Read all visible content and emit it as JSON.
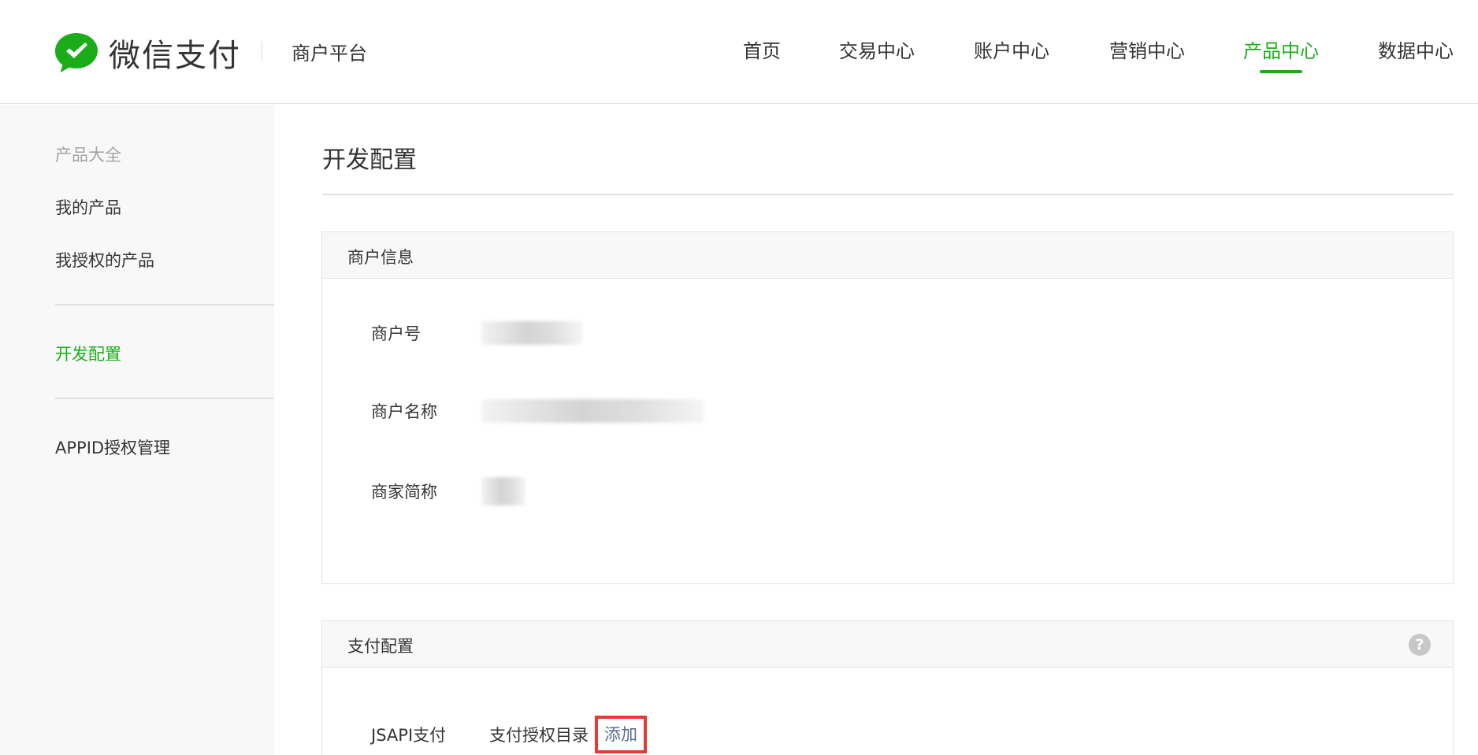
{
  "brand": {
    "logo_text": "微信支付",
    "platform": "商户平台",
    "accent_color": "#1aad19"
  },
  "nav": {
    "items": [
      {
        "label": "首页",
        "active": false
      },
      {
        "label": "交易中心",
        "active": false
      },
      {
        "label": "账户中心",
        "active": false
      },
      {
        "label": "营销中心",
        "active": false
      },
      {
        "label": "产品中心",
        "active": true
      },
      {
        "label": "数据中心",
        "active": false
      }
    ]
  },
  "sidebar": {
    "items": [
      {
        "label": "产品大全",
        "state": "muted"
      },
      {
        "label": "我的产品",
        "state": "normal"
      },
      {
        "label": "我授权的产品",
        "state": "normal"
      },
      {
        "label": "开发配置",
        "state": "active"
      },
      {
        "label": "APPID授权管理",
        "state": "normal"
      }
    ]
  },
  "main": {
    "title": "开发配置",
    "merchant_info": {
      "heading": "商户信息",
      "rows": [
        {
          "label": "商户号",
          "value_redacted": true
        },
        {
          "label": "商户名称",
          "value_redacted": true
        },
        {
          "label": "商家简称",
          "value_redacted": true
        }
      ]
    },
    "payment_config": {
      "heading": "支付配置",
      "help_icon": "help-circle-icon",
      "help_glyph": "?",
      "jsapi": {
        "label": "JSAPI支付",
        "dir_label": "支付授权目录",
        "add_link": "添加"
      }
    }
  }
}
